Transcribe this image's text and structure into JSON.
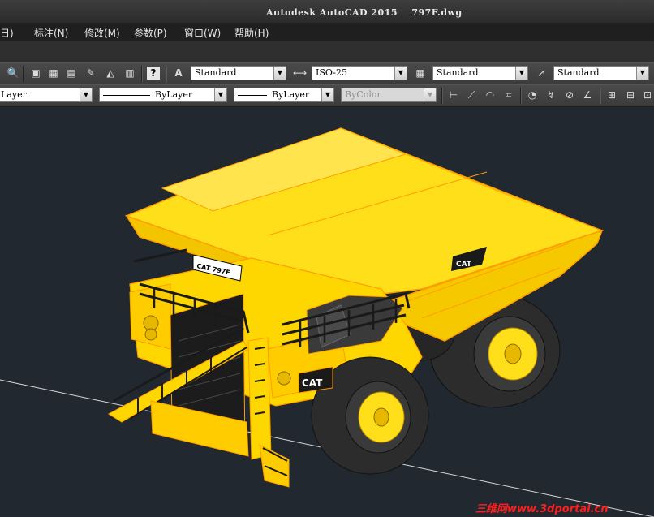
{
  "window": {
    "title": "Autodesk AutoCAD 2015    797F.dwg"
  },
  "menu": {
    "items": [
      "日)",
      "标注(N)",
      "修改(M)",
      "参数(P)",
      "窗口(W)",
      "帮助(H)"
    ]
  },
  "toolbar1": {
    "text_style": "Standard",
    "dim_style": "ISO-25",
    "table_style": "Standard",
    "mleader_style": "Standard"
  },
  "toolbar2": {
    "layer": "Layer",
    "linetype": "ByLayer",
    "lineweight": "ByLayer",
    "plotstyle": "ByColor"
  },
  "model": {
    "body_color": "#ffde1a",
    "edge_color": "#ff9e00",
    "tire_color": "#2c2c2c",
    "rail_color": "#1a1a1a",
    "badge_text": "CAT",
    "plate_text": "CAT 797F",
    "brand_text": "CAT"
  },
  "watermark": {
    "text": "三维网www.3dportal.cn",
    "color": "#ff1e1e"
  }
}
